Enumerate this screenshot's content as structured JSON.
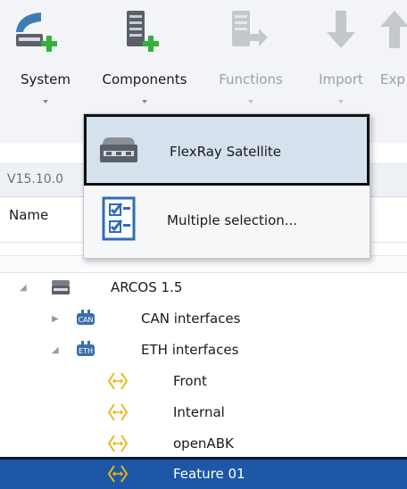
{
  "ribbon": {
    "buttons": [
      {
        "label": "System",
        "enabled": true
      },
      {
        "label": "Components",
        "enabled": true
      },
      {
        "label": "Functions",
        "enabled": false
      },
      {
        "label": "Import",
        "enabled": false
      },
      {
        "label": "Exp",
        "enabled": false
      }
    ]
  },
  "version_text": "V15.10.0",
  "columns": {
    "name": "Name"
  },
  "menu": {
    "items": [
      {
        "label": "FlexRay Satellite",
        "icon": "ecu-device-icon",
        "highlighted": true
      },
      {
        "label": "Multiple selection...",
        "icon": "multi-select-icon",
        "highlighted": false
      }
    ]
  },
  "tree": {
    "nodes": [
      {
        "label": "ARCOS 1.5",
        "icon": "ecu-icon",
        "expander": "expanded"
      },
      {
        "label": "CAN interfaces",
        "icon": "can-interface-icon",
        "expander": "collapsed"
      },
      {
        "label": "ETH interfaces",
        "icon": "eth-interface-icon",
        "expander": "expanded"
      },
      {
        "label": "Front",
        "icon": "network-port-icon"
      },
      {
        "label": "Internal",
        "icon": "network-port-icon"
      },
      {
        "label": "openABK",
        "icon": "network-port-icon"
      },
      {
        "label": "Feature 01",
        "icon": "network-port-icon",
        "selected": true
      }
    ]
  },
  "colors": {
    "accent_green": "#35b13a",
    "selection_blue": "#1e57a6",
    "menu_highlight": "#d5e1ec",
    "port_icon_yellow": "#e8b820"
  }
}
